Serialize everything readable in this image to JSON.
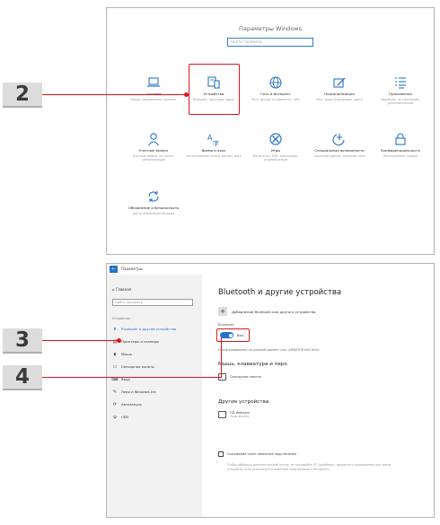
{
  "callouts": [
    "2",
    "3",
    "4"
  ],
  "windows_settings": {
    "title": "Параметры Windows",
    "search_placeholder": "Найти параметр",
    "tiles": [
      {
        "name": "Система",
        "desc": "Экран, уведомления, питание",
        "icon": "laptop-icon"
      },
      {
        "name": "Устройства",
        "desc": "Bluetooth, принтеры, мышь",
        "icon": "devices-icon"
      },
      {
        "name": "Сеть и Интернет",
        "desc": "Wi-Fi, режим «в самолете», VPN",
        "icon": "globe-icon"
      },
      {
        "name": "Персонализация",
        "desc": "Фон, экран блокировки, цвета",
        "icon": "paint-icon"
      },
      {
        "name": "Приложения",
        "desc": "Удаление, по умолчанию, дополнительные",
        "icon": "apps-list-icon"
      },
      {
        "name": "Учетные записи",
        "desc": "Учетные записи, эл. почта, синхронизация",
        "icon": "person-icon"
      },
      {
        "name": "Время и язык",
        "desc": "Распознавание голоса, регион, дата",
        "icon": "time-language-icon"
      },
      {
        "name": "Игры",
        "desc": "Меню игры, DVR, трансляция, игровой режим",
        "icon": "xbox-icon"
      },
      {
        "name": "Специальные возможности",
        "desc": "Экранный диктор, экранная лупа",
        "icon": "accessibility-icon"
      },
      {
        "name": "Конфиденциальность",
        "desc": "Расположение, камера",
        "icon": "lock-icon"
      },
      {
        "name": "Обновление и безопасность",
        "desc": "Центр обновления Windows",
        "icon": "update-icon"
      }
    ]
  },
  "devices_page": {
    "window_title": "Параметры",
    "sidebar": {
      "home": "Главная",
      "search_placeholder": "Найти параметр",
      "group_label": "Устройства",
      "items": [
        {
          "label": "Bluetooth и другие устройства",
          "icon": "bluetooth-icon",
          "active": true
        },
        {
          "label": "Принтеры и сканеры",
          "icon": "printer-icon",
          "active": false
        },
        {
          "label": "Мышь",
          "icon": "mouse-icon",
          "active": false
        },
        {
          "label": "Сенсорная панель",
          "icon": "touchpad-icon",
          "active": false
        },
        {
          "label": "Ввод",
          "icon": "keyboard-icon",
          "active": false
        },
        {
          "label": "Перо и Windows Ink",
          "icon": "pen-icon",
          "active": false
        },
        {
          "label": "Автозапуск",
          "icon": "autoplay-icon",
          "active": false
        },
        {
          "label": "USB",
          "icon": "usb-icon",
          "active": false
        }
      ]
    },
    "main": {
      "heading": "Bluetooth и другие устройства",
      "add_device": "Добавление Bluetooth или другого устройства",
      "bluetooth_label": "Bluetooth",
      "bluetooth_state": "Вкл.",
      "discoverable": "Обнаруживаемое на данный момент как «DESKTOP-9GCU00»",
      "section_mouse": "Мышь, клавиатура и перо",
      "mouse_device": "Сенсорная панель",
      "section_other": "Другие устройства",
      "other_device": "HD Webcam",
      "other_device_sub": "Подключено",
      "swift_pair": "Скачивание через лимитные подключения",
      "swift_pair_note": "Чтобы избежать дополнительной платы, не скачивайте ПО (драйверы, сведения и приложения) для новых устройств, если используется лимитное подключение к Интернету."
    }
  }
}
